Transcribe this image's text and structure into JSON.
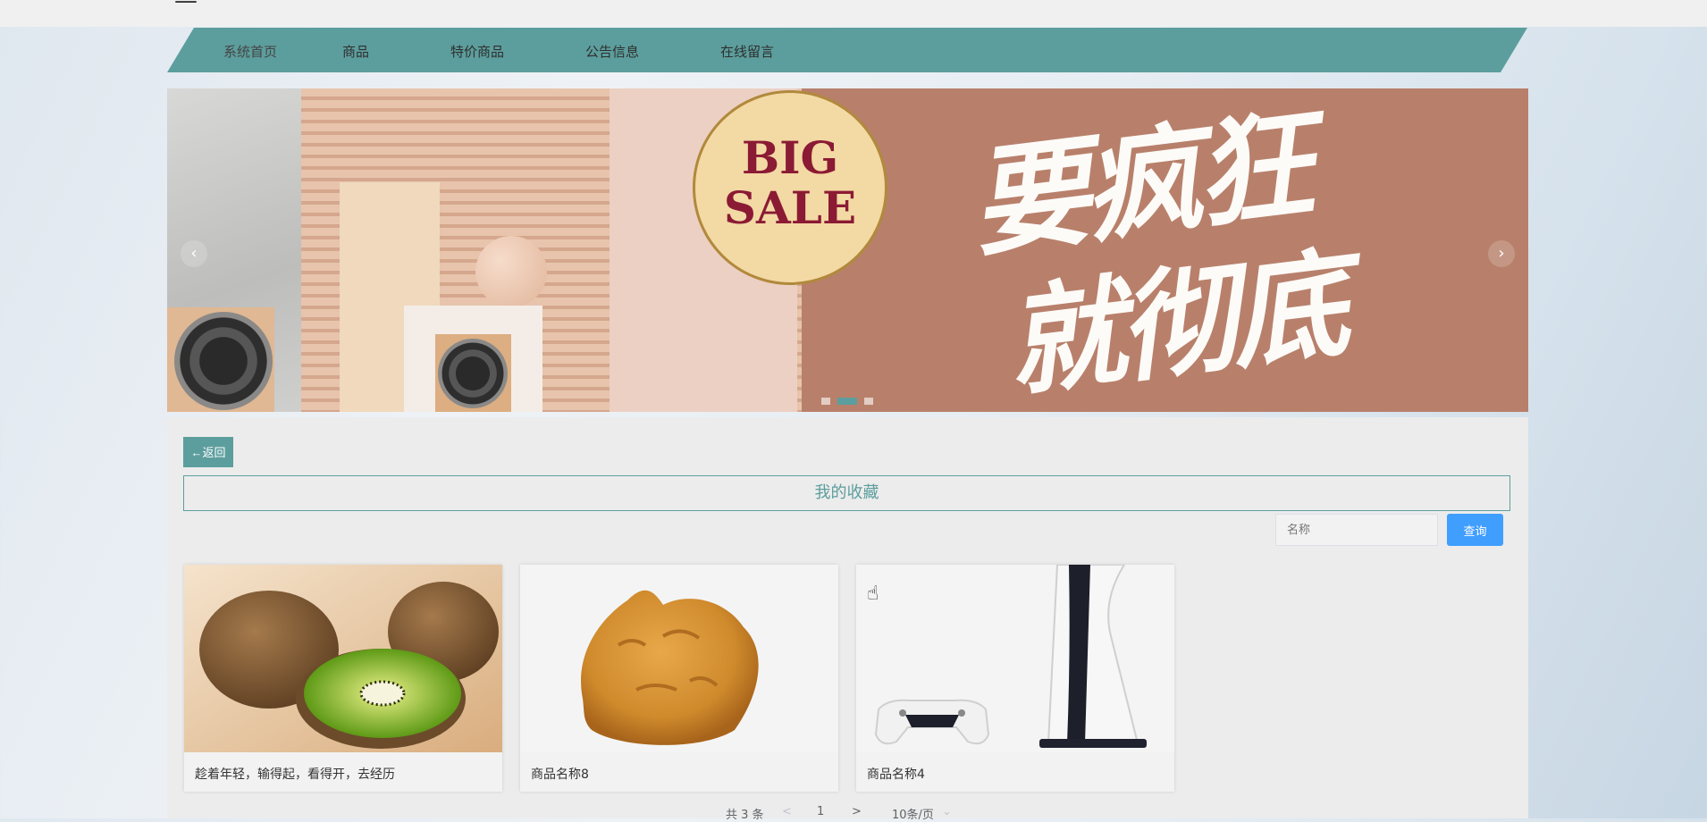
{
  "header": {
    "title_fragment": "—"
  },
  "nav": {
    "items": [
      {
        "label": "系统首页",
        "active": true
      },
      {
        "label": "商品",
        "active": false
      },
      {
        "label": "特价商品",
        "active": false
      },
      {
        "label": "公告信息",
        "active": false
      },
      {
        "label": "在线留言",
        "active": false
      }
    ]
  },
  "banner": {
    "badge_line1": "BIG",
    "badge_line2": "SALE",
    "slogan_line1": "要疯狂",
    "slogan_line2": "就彻底",
    "prev_arrow": "‹",
    "next_arrow": "›",
    "active_slide_index": 2,
    "slide_count": 3
  },
  "page": {
    "back_label": "←返回",
    "title": "我的收藏",
    "search": {
      "placeholder": "名称",
      "button_label": "查询"
    }
  },
  "products": [
    {
      "name": "趁着年轻，输得起，看得开，去经历",
      "image": "kiwi-fruit"
    },
    {
      "name": "商品名称8",
      "image": "fried-chicken"
    },
    {
      "name": "商品名称4",
      "image": "game-console"
    }
  ],
  "pagination": {
    "total": "共 3 条",
    "prev": "<",
    "current_page": "1",
    "next": ">",
    "page_size": "10条/页",
    "dropdown_icon": "chevron-down-icon"
  },
  "colors": {
    "accent": "#5c9e9d",
    "primary_button": "#409eff"
  }
}
